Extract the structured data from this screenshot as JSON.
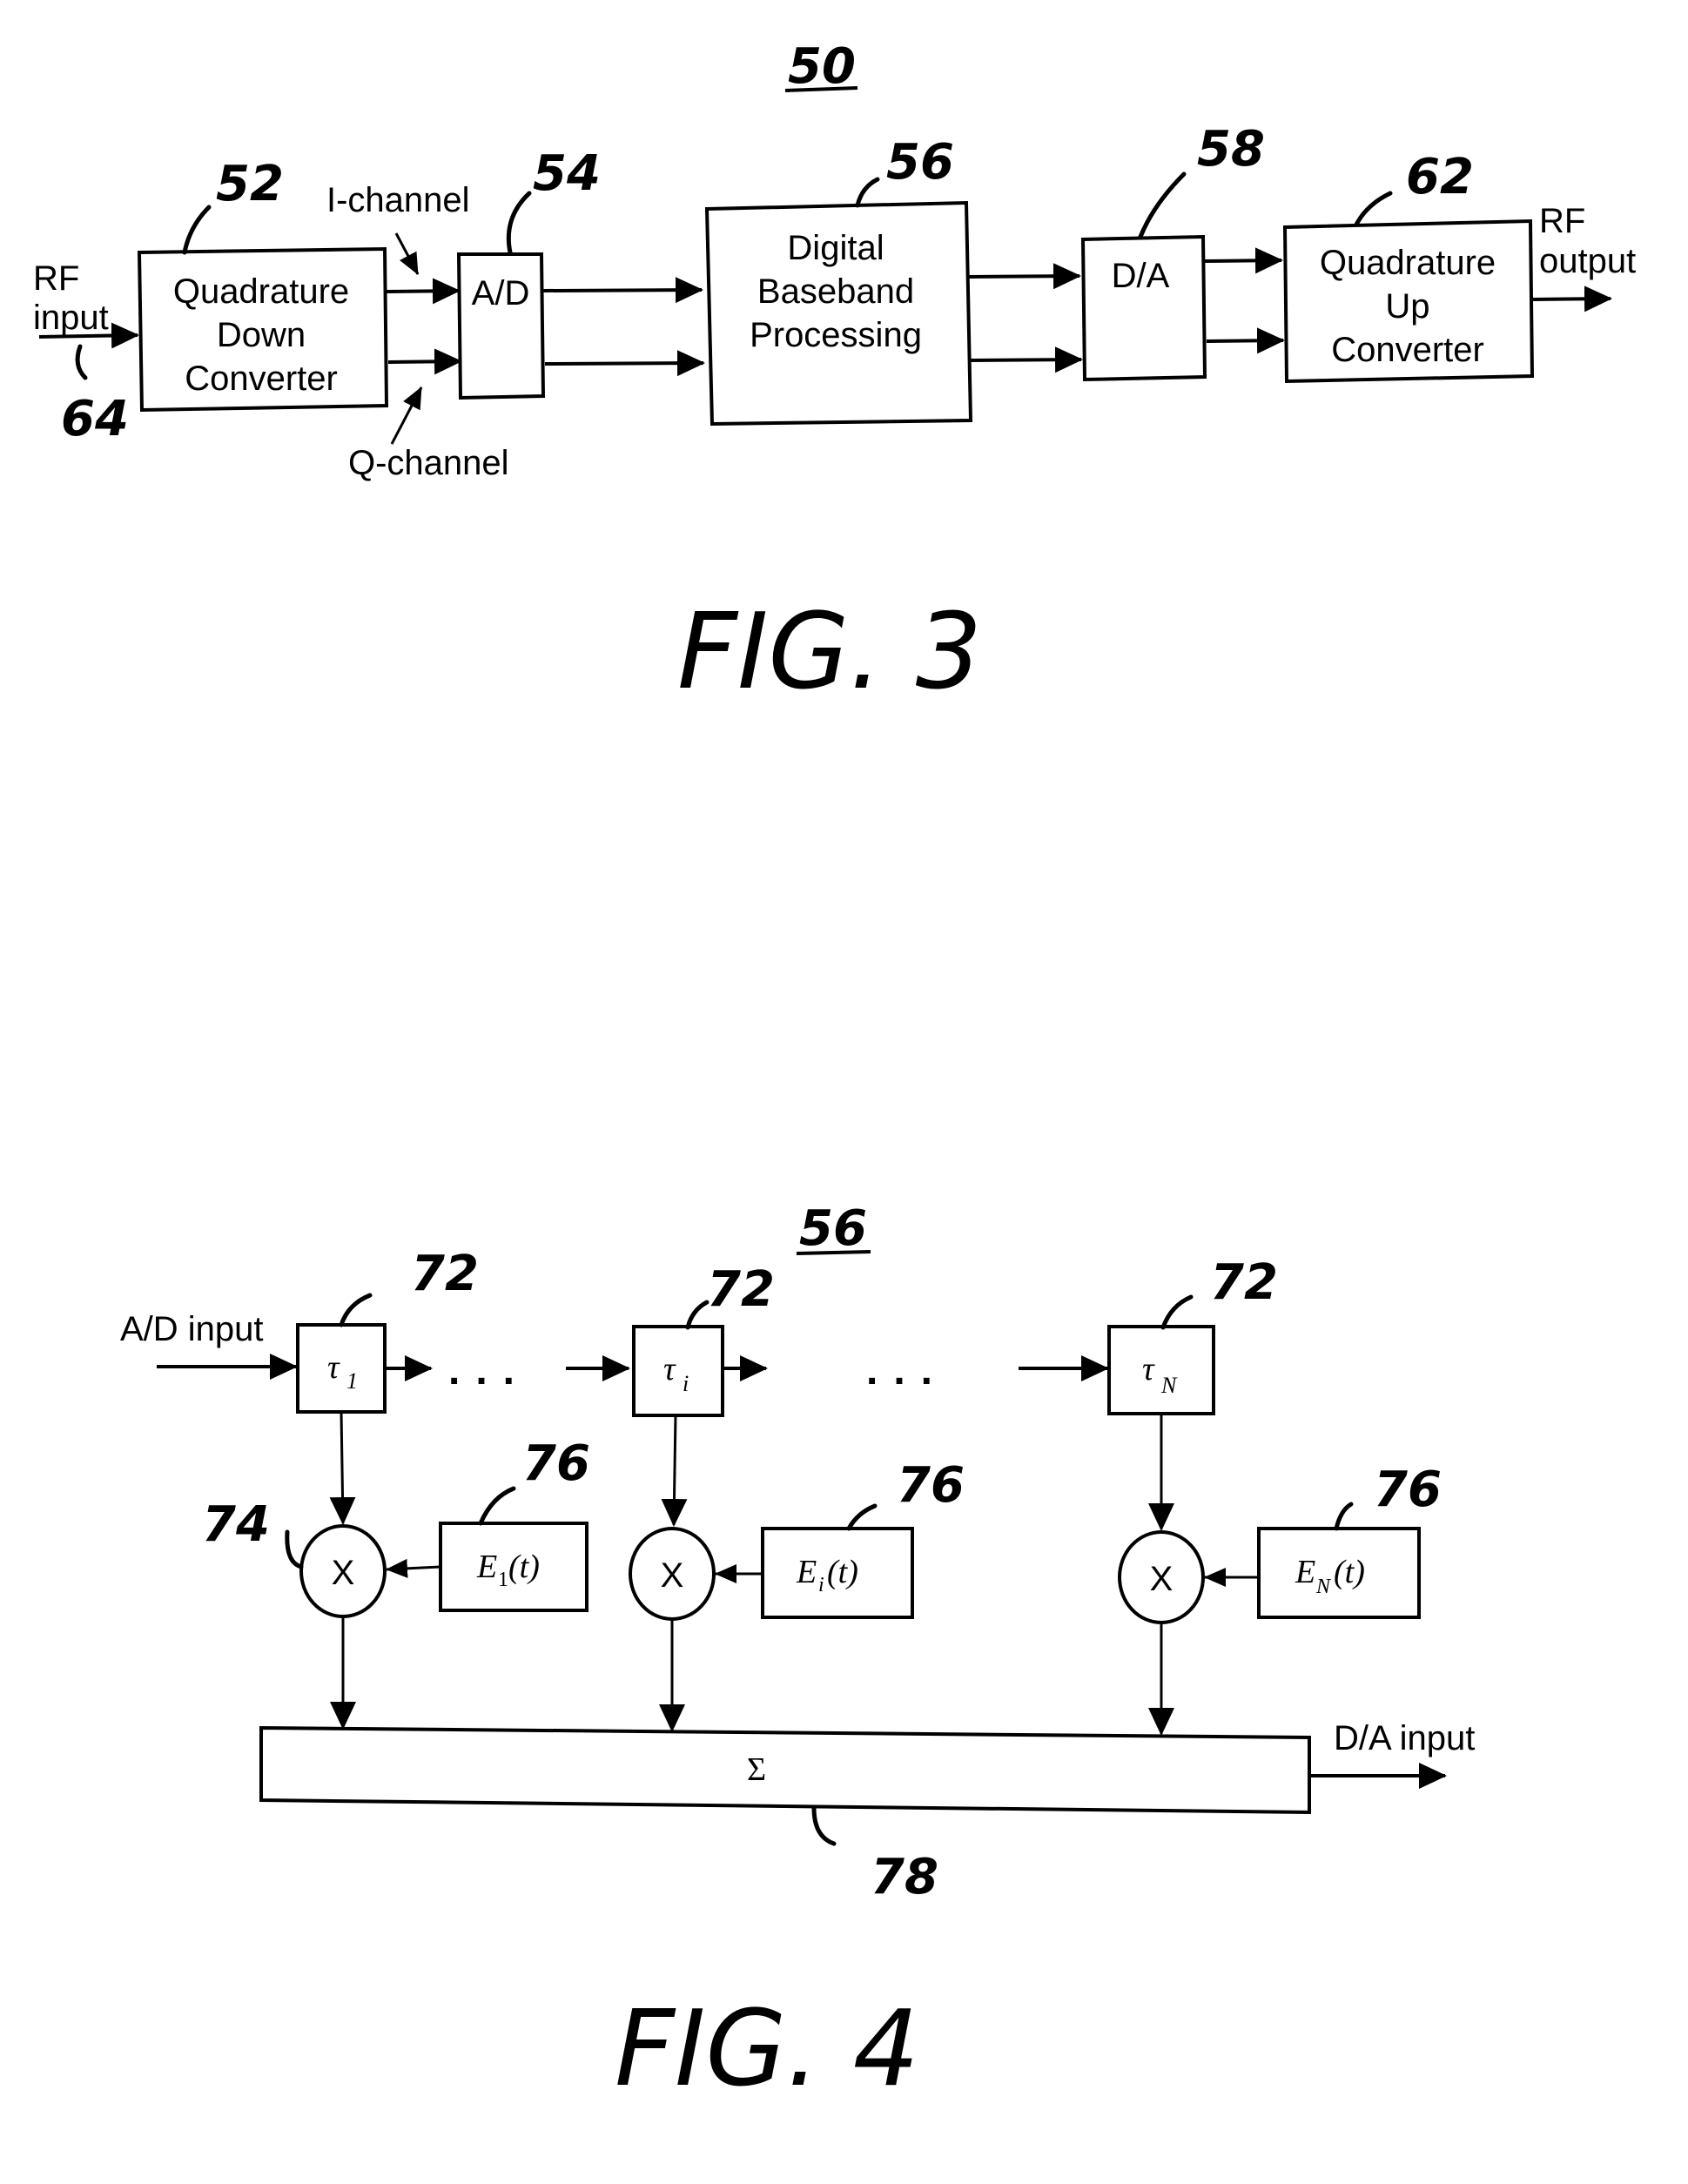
{
  "fig3": {
    "ref_number": "50",
    "caption": "FIG. 3",
    "input_label_line1": "RF",
    "input_label_line2": "input",
    "input_ref": "64",
    "output_label_line1": "RF",
    "output_label_line2": "output",
    "i_channel_label": "I-channel",
    "q_channel_label": "Q-channel",
    "blocks": [
      {
        "ref": "52",
        "lines": [
          "Quadrature",
          "Down",
          "Converter"
        ]
      },
      {
        "ref": "54",
        "lines": [
          "A/D"
        ]
      },
      {
        "ref": "56",
        "lines": [
          "Digital",
          "Baseband",
          "Processing"
        ]
      },
      {
        "ref": "58",
        "lines": [
          "D/A"
        ]
      },
      {
        "ref": "62",
        "lines": [
          "Quadrature",
          "Up",
          "Converter"
        ]
      }
    ]
  },
  "fig4": {
    "ref_number": "56",
    "caption": "FIG. 4",
    "input_label": "A/D input",
    "output_label": "D/A input",
    "ellipsis": "...",
    "delays": [
      {
        "ref": "72",
        "symbol": "τ",
        "sub": "1"
      },
      {
        "ref": "72",
        "symbol": "τ",
        "sub": "i"
      },
      {
        "ref": "72",
        "symbol": "τ",
        "sub": "N"
      }
    ],
    "multiplier_symbol": "X",
    "multiplier_ref": "74",
    "weights": [
      {
        "ref": "76",
        "symbol": "E",
        "sub": "1",
        "arg": "(t)"
      },
      {
        "ref": "76",
        "symbol": "E",
        "sub": "i",
        "arg": "(t)"
      },
      {
        "ref": "76",
        "symbol": "E",
        "sub": "N",
        "arg": "(t)"
      }
    ],
    "summer_symbol": "Σ",
    "summer_ref": "78"
  }
}
